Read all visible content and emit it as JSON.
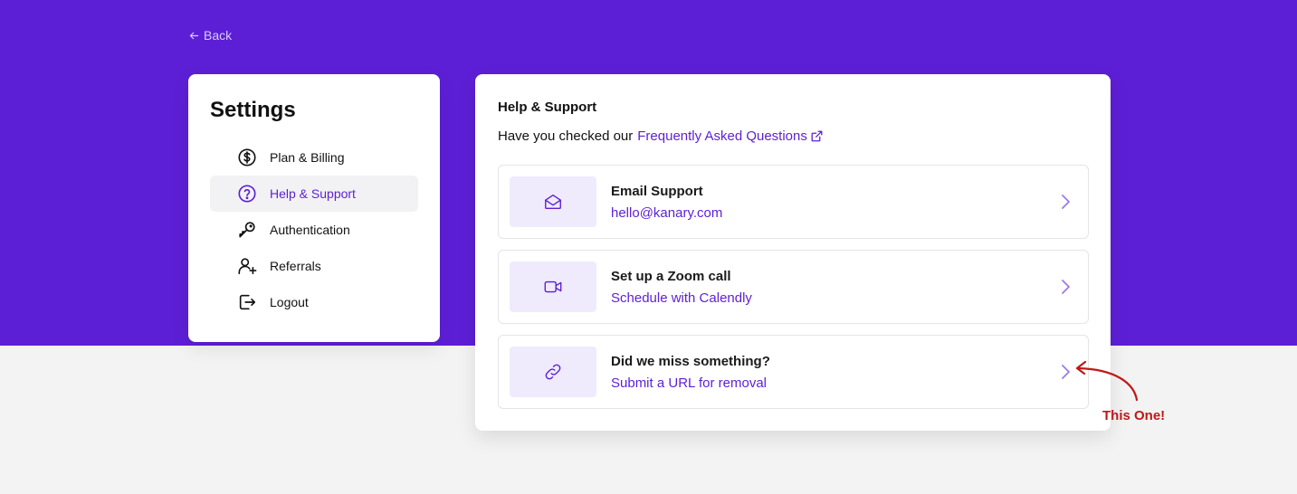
{
  "colors": {
    "brand": "#5d1fd5",
    "accent_text": "#5d1fd5",
    "annotation": "#c01818",
    "icon_bg": "#efebfd"
  },
  "back": {
    "label": "Back",
    "icon": "arrow-left-icon"
  },
  "settings": {
    "title": "Settings",
    "items": [
      {
        "label": "Plan & Billing",
        "icon": "dollar-circle-icon",
        "active": false
      },
      {
        "label": "Help & Support",
        "icon": "question-circle-icon",
        "active": true
      },
      {
        "label": "Authentication",
        "icon": "key-icon",
        "active": false
      },
      {
        "label": "Referrals",
        "icon": "user-plus-icon",
        "active": false
      },
      {
        "label": "Logout",
        "icon": "logout-icon",
        "active": false
      }
    ]
  },
  "help": {
    "title": "Help & Support",
    "faq_prefix": "Have you checked our",
    "faq_link": "Frequently Asked Questions",
    "options": [
      {
        "title": "Email Support",
        "subtitle": "hello@kanary.com",
        "icon": "envelope-open-icon"
      },
      {
        "title": "Set up a Zoom call",
        "subtitle": "Schedule with Calendly",
        "icon": "video-camera-icon"
      },
      {
        "title": "Did we miss something?",
        "subtitle": "Submit a URL for removal",
        "icon": "link-icon"
      }
    ]
  },
  "annotation": {
    "label": "This One!"
  }
}
